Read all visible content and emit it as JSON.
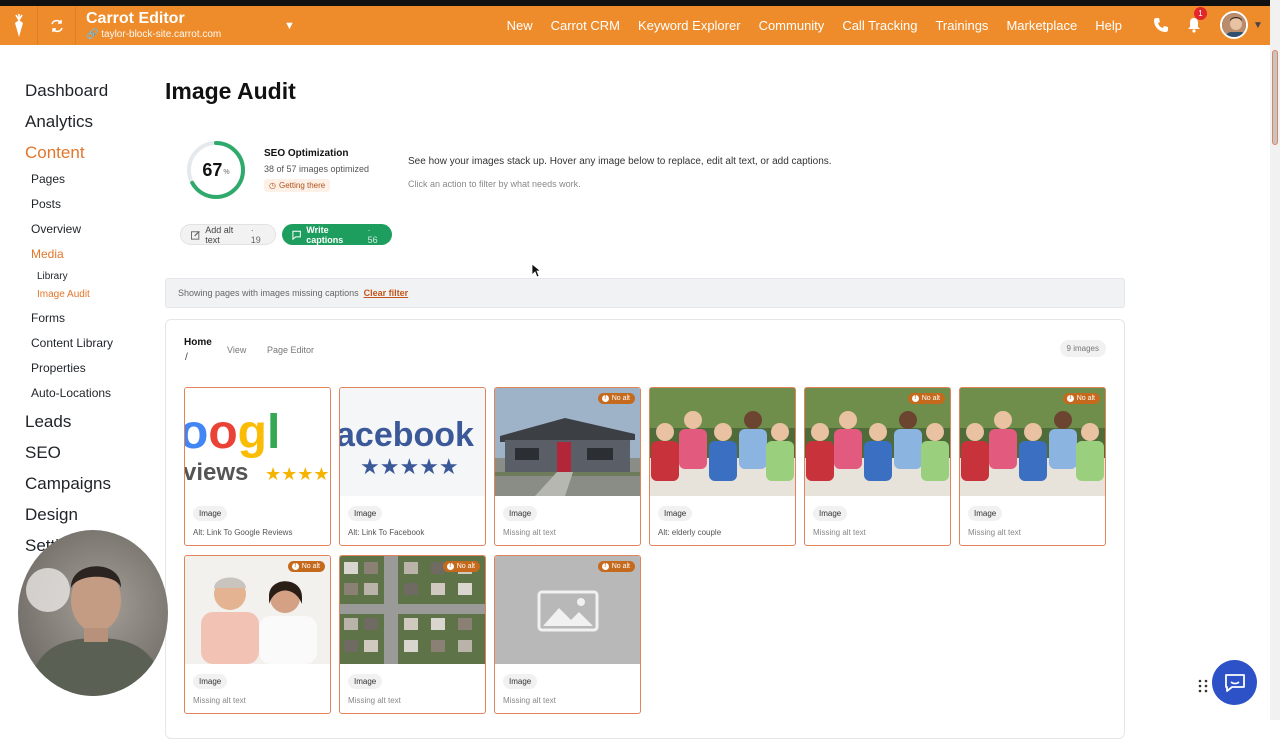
{
  "topbar": {
    "app_title": "Carrot Editor",
    "site": "taylor-block-site.carrot.com",
    "nav": [
      "New",
      "Carrot CRM",
      "Keyword Explorer",
      "Community",
      "Call Tracking",
      "Trainings",
      "Marketplace",
      "Help"
    ],
    "notification_count": "1",
    "accent": "#ee8c2c"
  },
  "sidebar": {
    "top_items": [
      "Dashboard",
      "Analytics",
      "Content"
    ],
    "content_sub": [
      "Pages",
      "Posts",
      "Overview",
      "Media"
    ],
    "media_sub": [
      "Library",
      "Image Audit"
    ],
    "content_sub_after": [
      "Forms",
      "Content Library",
      "Properties",
      "Auto-Locations"
    ],
    "bottom_items": [
      "Leads",
      "SEO",
      "Campaigns",
      "Design",
      "Settin"
    ]
  },
  "main": {
    "title": "Image Audit",
    "score": "67",
    "score_unit": "%",
    "score_fraction": 0.67,
    "seo_title": "SEO Optimization",
    "seo_count": "38 of 57 images optimized",
    "seo_badge": "Getting there",
    "description": "See how your images stack up. Hover any image below to replace, edit alt text, or add captions.",
    "hint": "Click an action to filter by what needs work.",
    "pill_alt_label": "Add alt text",
    "pill_alt_count": "· 19",
    "pill_cap_label": "Write captions",
    "pill_cap_count": "· 56",
    "filter_text": "Showing pages with images missing captions",
    "clear_filter": "Clear filter"
  },
  "card": {
    "page": "Home",
    "slash": "/",
    "view": "View",
    "page_editor": "Page Editor",
    "image_count": "9 images",
    "thumbs": [
      {
        "tag": "Image",
        "alt": "Alt: Link To Google Reviews",
        "no_alt": false,
        "kind": "google"
      },
      {
        "tag": "Image",
        "alt": "Alt: Link To Facebook",
        "no_alt": false,
        "kind": "facebook"
      },
      {
        "tag": "Image",
        "alt": "Missing alt text",
        "no_alt": true,
        "kind": "house"
      },
      {
        "tag": "Image",
        "alt": "Alt: elderly couple",
        "no_alt": false,
        "kind": "group"
      },
      {
        "tag": "Image",
        "alt": "Missing alt text",
        "no_alt": true,
        "kind": "group"
      },
      {
        "tag": "Image",
        "alt": "Missing alt text",
        "no_alt": true,
        "kind": "group"
      },
      {
        "tag": "Image",
        "alt": "Missing alt text",
        "no_alt": true,
        "kind": "couple"
      },
      {
        "tag": "Image",
        "alt": "Missing alt text",
        "no_alt": true,
        "kind": "aerial"
      },
      {
        "tag": "Image",
        "alt": "Missing alt text",
        "no_alt": true,
        "kind": "placeholder"
      }
    ],
    "no_alt_label": "No alt",
    "google_text": "oogl",
    "google_sub": "views",
    "facebook_text": "acebook"
  }
}
